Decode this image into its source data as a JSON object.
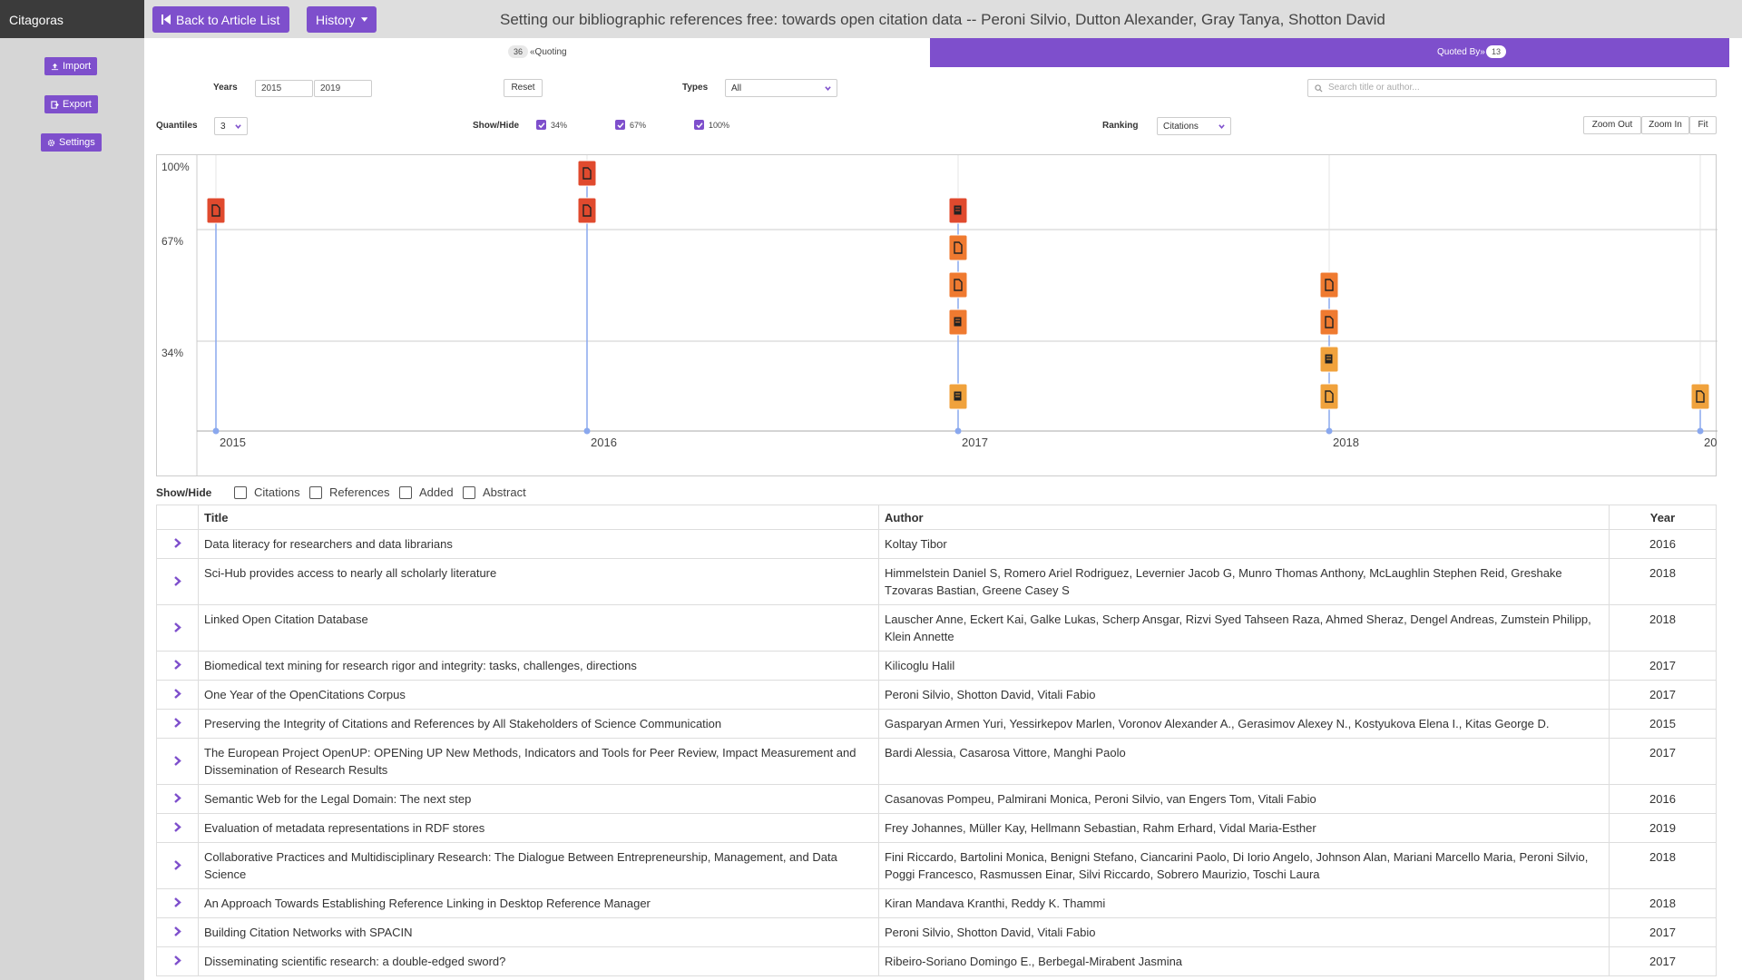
{
  "app": {
    "title": "Citagoras"
  },
  "sidebar": {
    "import": "Import",
    "export": "Export",
    "settings": "Settings"
  },
  "topbar": {
    "back": "Back to Article List",
    "history": "History",
    "page_title": "Setting our bibliographic references free: towards open citation data -- Peroni Silvio, Dutton Alexander, Gray Tanya, Shotton David"
  },
  "tabs": {
    "quoting_count": "36",
    "quoting_label": "«Quoting",
    "quoted_label": "Quoted By»",
    "quoted_count": "13"
  },
  "filters": {
    "years_label": "Years",
    "year_from": "2015",
    "year_to": "2019",
    "reset": "Reset",
    "types_label": "Types",
    "types_value": "All",
    "search_placeholder": "Search title or author...",
    "quantiles_label": "Quantiles",
    "quantiles_value": "3",
    "showhide_label": "Show/Hide",
    "q34": "34%",
    "q67": "67%",
    "q100": "100%",
    "ranking_label": "Ranking",
    "ranking_value": "Citations",
    "zoom_out": "Zoom Out",
    "zoom_in": "Zoom In",
    "fit": "Fit"
  },
  "chart_data": {
    "type": "scatter",
    "x_axis_ticks": [
      "2015",
      "2016",
      "2017",
      "2018",
      "20"
    ],
    "y_bands": [
      "100%",
      "67%",
      "34%"
    ],
    "colors": {
      "top": "#e04a2e",
      "mid": "#ef7a30",
      "low": "#f0a23c",
      "axis": "#8aa8ee"
    },
    "points": [
      {
        "year": 2015,
        "band": "100%",
        "slot": 1,
        "kind": "article"
      },
      {
        "year": 2016,
        "band": "100%",
        "slot": 0,
        "kind": "article"
      },
      {
        "year": 2016,
        "band": "100%",
        "slot": 1,
        "kind": "article"
      },
      {
        "year": 2017,
        "band": "100%",
        "slot": 1,
        "kind": "book"
      },
      {
        "year": 2017,
        "band": "67%",
        "slot": 0,
        "kind": "article"
      },
      {
        "year": 2017,
        "band": "67%",
        "slot": 1,
        "kind": "article"
      },
      {
        "year": 2017,
        "band": "67%",
        "slot": 2,
        "kind": "book"
      },
      {
        "year": 2017,
        "band": "34%",
        "slot": 1,
        "kind": "book"
      },
      {
        "year": 2018,
        "band": "67%",
        "slot": 1,
        "kind": "article"
      },
      {
        "year": 2018,
        "band": "67%",
        "slot": 2,
        "kind": "article"
      },
      {
        "year": 2018,
        "band": "34%",
        "slot": 0,
        "kind": "book"
      },
      {
        "year": 2018,
        "band": "34%",
        "slot": 1,
        "kind": "article"
      },
      {
        "year": 2019,
        "band": "34%",
        "slot": 1,
        "kind": "article"
      }
    ]
  },
  "table_options": {
    "label": "Show/Hide",
    "citations": "Citations",
    "references": "References",
    "added": "Added",
    "abstract": "Abstract"
  },
  "table": {
    "headers": {
      "title": "Title",
      "author": "Author",
      "year": "Year"
    },
    "rows": [
      {
        "title": "Data literacy for researchers and data librarians",
        "author": "Koltay Tibor",
        "year": "2016"
      },
      {
        "title": "Sci-Hub provides access to nearly all scholarly literature",
        "author": "Himmelstein Daniel S, Romero Ariel Rodriguez, Levernier Jacob G, Munro Thomas Anthony, McLaughlin Stephen Reid, Greshake Tzovaras Bastian, Greene Casey S",
        "year": "2018"
      },
      {
        "title": "Linked Open Citation Database",
        "author": "Lauscher Anne, Eckert Kai, Galke Lukas, Scherp Ansgar, Rizvi Syed Tahseen Raza, Ahmed Sheraz, Dengel Andreas, Zumstein Philipp, Klein Annette",
        "year": "2018"
      },
      {
        "title": "Biomedical text mining for research rigor and integrity: tasks, challenges, directions",
        "author": "Kilicoglu Halil",
        "year": "2017"
      },
      {
        "title": "One Year of the OpenCitations Corpus",
        "author": "Peroni Silvio, Shotton David, Vitali Fabio",
        "year": "2017"
      },
      {
        "title": "Preserving the Integrity of Citations and References by All Stakeholders of Science Communication",
        "author": "Gasparyan Armen Yuri, Yessirkepov Marlen, Voronov Alexander A., Gerasimov Alexey N., Kostyukova Elena I., Kitas George D.",
        "year": "2015"
      },
      {
        "title": "The European Project OpenUP: OPENing UP New Methods, Indicators and Tools for Peer Review, Impact Measurement and Dissemination of Research Results",
        "author": "Bardi Alessia, Casarosa Vittore, Manghi Paolo",
        "year": "2017"
      },
      {
        "title": "Semantic Web for the Legal Domain: The next step",
        "author": "Casanovas Pompeu, Palmirani Monica, Peroni Silvio, van Engers Tom, Vitali Fabio",
        "year": "2016"
      },
      {
        "title": "Evaluation of metadata representations in RDF stores",
        "author": "Frey Johannes, Müller Kay, Hellmann Sebastian, Rahm Erhard, Vidal Maria-Esther",
        "year": "2019"
      },
      {
        "title": "Collaborative Practices and Multidisciplinary Research: The Dialogue Between Entrepreneurship, Management, and Data Science",
        "author": "Fini Riccardo, Bartolini Monica, Benigni Stefano, Ciancarini Paolo, Di Iorio Angelo, Johnson Alan, Mariani Marcello Maria, Peroni Silvio, Poggi Francesco, Rasmussen Einar, Silvi Riccardo, Sobrero Maurizio, Toschi Laura",
        "year": "2018"
      },
      {
        "title": "An Approach Towards Establishing Reference Linking in Desktop Reference Manager",
        "author": "Kiran Mandava Kranthi, Reddy K. Thammi",
        "year": "2018"
      },
      {
        "title": "Building Citation Networks with SPACIN",
        "author": "Peroni Silvio, Shotton David, Vitali Fabio",
        "year": "2017"
      },
      {
        "title": "Disseminating scientific research: a double-edged sword?",
        "author": "Ribeiro-Soriano Domingo E., Berbegal-Mirabent Jasmina",
        "year": "2017"
      }
    ]
  }
}
